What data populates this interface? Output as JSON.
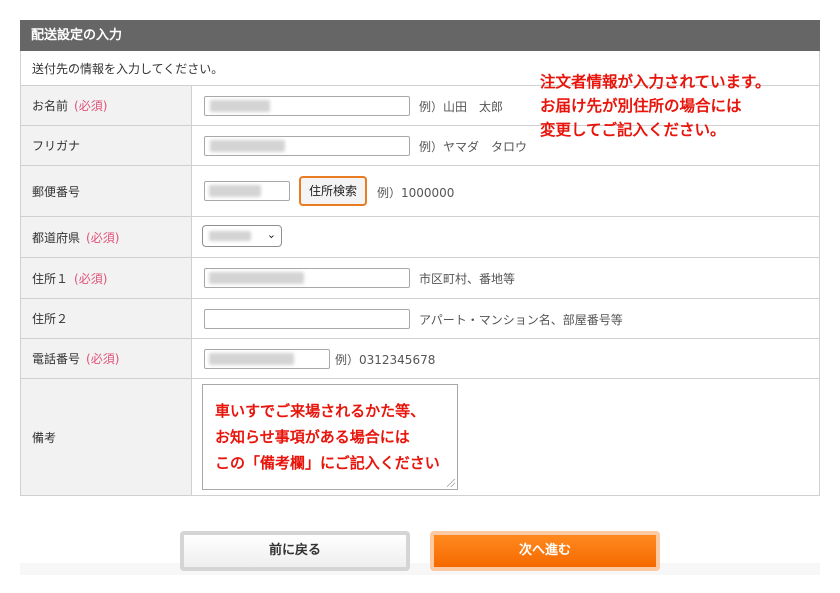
{
  "form": {
    "title": "配送設定の入力",
    "intro": "送付先の情報を入力してください。",
    "notice_lines": [
      "注文者情報が入力されています。",
      "お届け先が別住所の場合には",
      "変更してご記入ください。"
    ],
    "required_mark": "(必須)",
    "fields": {
      "name": {
        "label": "お名前",
        "required": true,
        "example": "例）山田　太郎"
      },
      "furigana": {
        "label": "フリガナ",
        "required": false,
        "example": "例）ヤマダ　タロウ"
      },
      "postal": {
        "label": "郵便番号",
        "required": false,
        "search_label": "住所検索",
        "example": "例）1000000"
      },
      "prefecture": {
        "label": "都道府県",
        "required": true
      },
      "address1": {
        "label": "住所１",
        "required": true,
        "example": "市区町村、番地等"
      },
      "address2": {
        "label": "住所２",
        "required": false,
        "example": "アパート・マンション名、部屋番号等"
      },
      "phone": {
        "label": "電話番号",
        "required": true,
        "example": "例）0312345678"
      },
      "remarks": {
        "label": "備考",
        "notice_lines": [
          "車いすでご来場されるかた等、",
          "お知らせ事項がある場合には",
          "この「備考欄」にご記入ください"
        ]
      }
    }
  },
  "buttons": {
    "back": "前に戻る",
    "next": "次へ進む"
  },
  "colors": {
    "header": "#666666",
    "required": "#e0547b",
    "notice": "#e8150c",
    "accent": "#f56a00"
  }
}
